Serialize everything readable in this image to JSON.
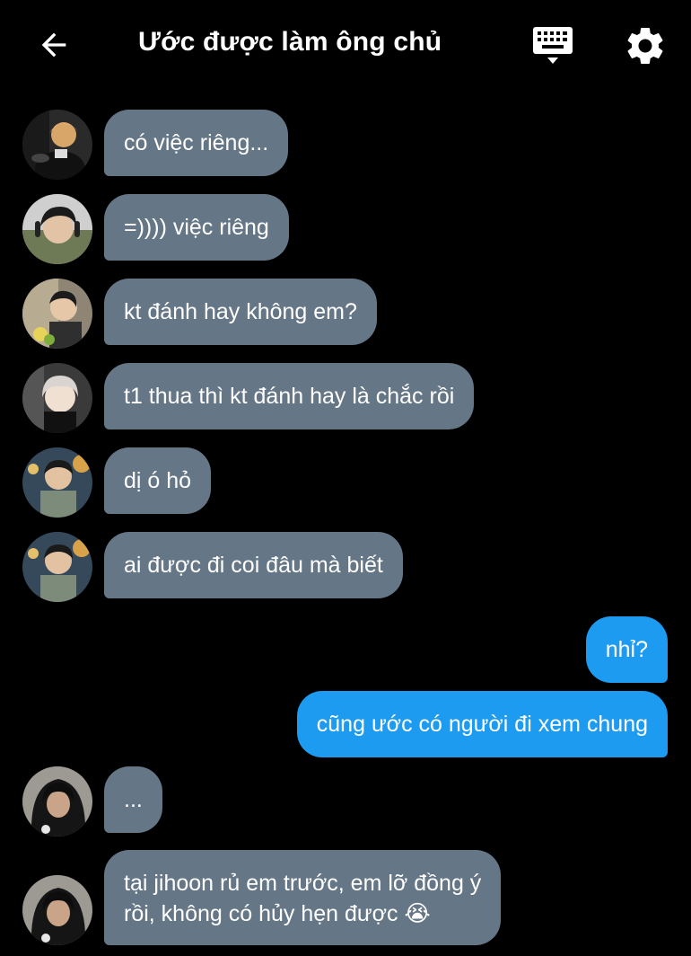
{
  "header": {
    "title": "Ước được làm ông chủ"
  },
  "messages": [
    {
      "side": "in",
      "text": "có việc riêng..."
    },
    {
      "side": "in",
      "text": "=)))) việc riêng"
    },
    {
      "side": "in",
      "text": "kt đánh hay không em?"
    },
    {
      "side": "in",
      "text": "t1 thua thì kt đánh hay là chắc rồi"
    },
    {
      "side": "in",
      "text": "dị ó hỏ"
    },
    {
      "side": "in",
      "text": "ai được đi coi đâu mà biết"
    },
    {
      "side": "out",
      "text": "nhỉ?"
    },
    {
      "side": "out",
      "text": "cũng ước có người đi xem chung"
    },
    {
      "side": "in",
      "text": "..."
    },
    {
      "side": "in",
      "line1": "tại jihoon rủ em trước, em lỡ đồng ý",
      "line2": "rồi, không có hủy hẹn được 😭"
    }
  ],
  "colors": {
    "background": "#000000",
    "incoming_bubble": "#657786",
    "outgoing_bubble": "#1d9bf0"
  },
  "icons": {
    "back": "arrow-left-icon",
    "keyboard": "keyboard-icon",
    "settings": "gear-icon"
  }
}
